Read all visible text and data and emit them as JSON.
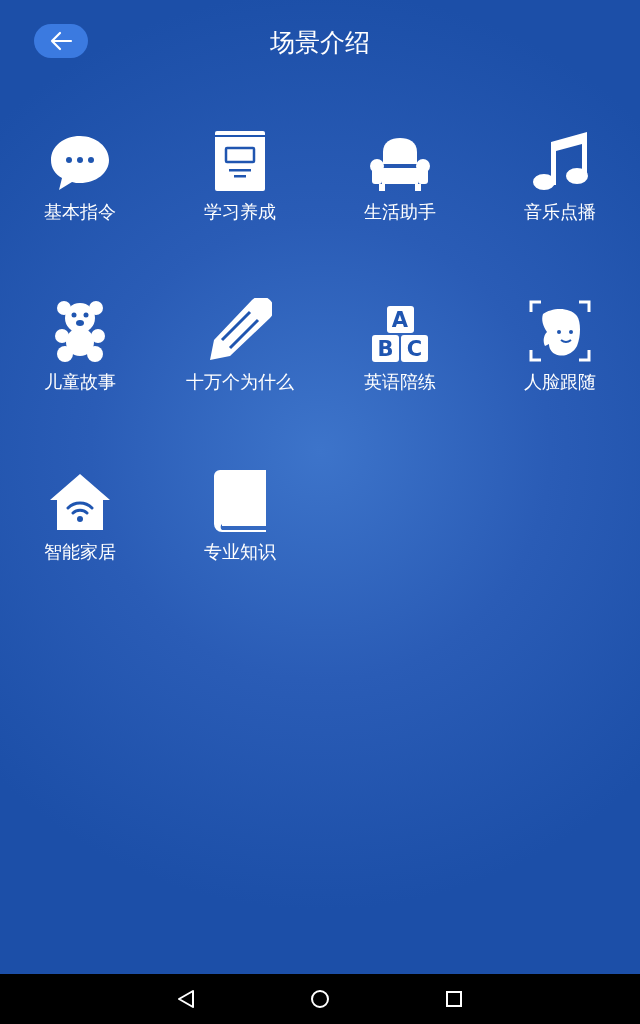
{
  "header": {
    "title": "场景介绍"
  },
  "items": [
    {
      "label": "基本指令",
      "kind": "chat"
    },
    {
      "label": "学习养成",
      "kind": "document"
    },
    {
      "label": "生活助手",
      "kind": "armchair"
    },
    {
      "label": "音乐点播",
      "kind": "music"
    },
    {
      "label": "儿童故事",
      "kind": "bear"
    },
    {
      "label": "十万个为什么",
      "kind": "pencil"
    },
    {
      "label": "英语陪练",
      "kind": "blocks",
      "letters": [
        "A",
        "B",
        "C"
      ]
    },
    {
      "label": "人脸跟随",
      "kind": "face"
    },
    {
      "label": "智能家居",
      "kind": "home"
    },
    {
      "label": "专业知识",
      "kind": "book"
    }
  ]
}
